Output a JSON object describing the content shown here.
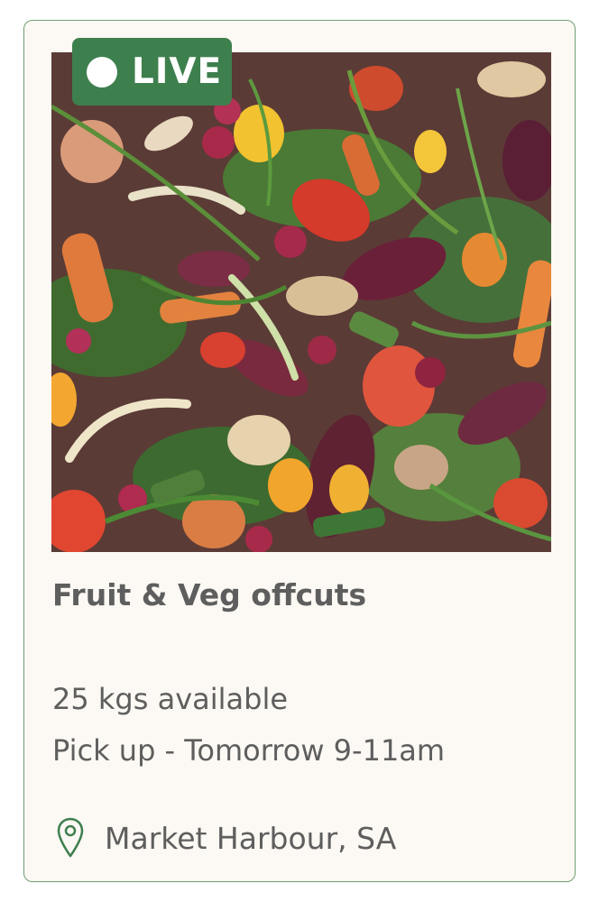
{
  "listing": {
    "status_label": "LIVE",
    "title": "Fruit & Veg offcuts",
    "quantity": "25 kgs available",
    "pickup": "Pick up - Tomorrow 9-11am",
    "location": "Market Harbour, SA"
  },
  "icons": {
    "status": "dot-icon",
    "location": "map-pin-icon"
  },
  "colors": {
    "accent": "#3e7f4e",
    "card_background": "#fcf8f3",
    "card_border": "#6f9e73",
    "text": "#5e5e5e"
  }
}
